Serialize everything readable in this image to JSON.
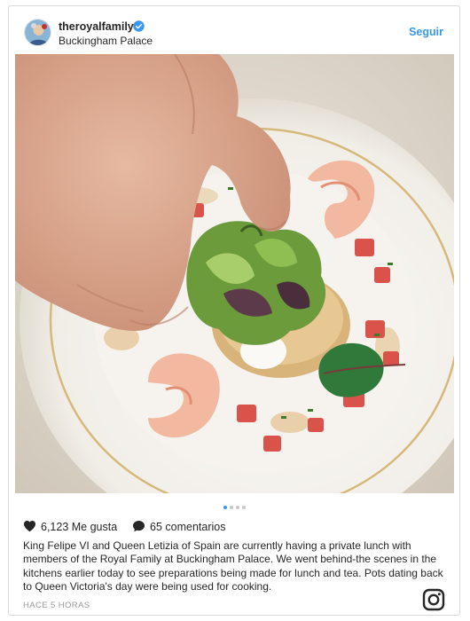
{
  "post": {
    "username": "theroyalfamily",
    "verified_icon": "verified-badge-icon",
    "location": "Buckingham Palace",
    "follow_label": "Seguir",
    "likes_text": "6,123 Me gusta",
    "comments_text": "65 comentarios",
    "caption": "King Felipe VI and Queen Letizia of Spain are currently having a private lunch with members of the Royal Family at Buckingham Palace. We went behind-the scenes in the kitchens earlier today to see preparations being made for lunch and tea. Pots dating back to Queen Victoria's day were being used for cooking.",
    "timestamp": "HACE 5 HORAS",
    "carousel": {
      "count": 4,
      "active_index": 0
    }
  },
  "colors": {
    "accent": "#3897f0",
    "text": "#262626",
    "muted": "#999999",
    "border": "#dbdbdb"
  },
  "icons": {
    "like": "heart-icon",
    "comment": "comment-icon",
    "brand": "instagram-logo-icon"
  }
}
